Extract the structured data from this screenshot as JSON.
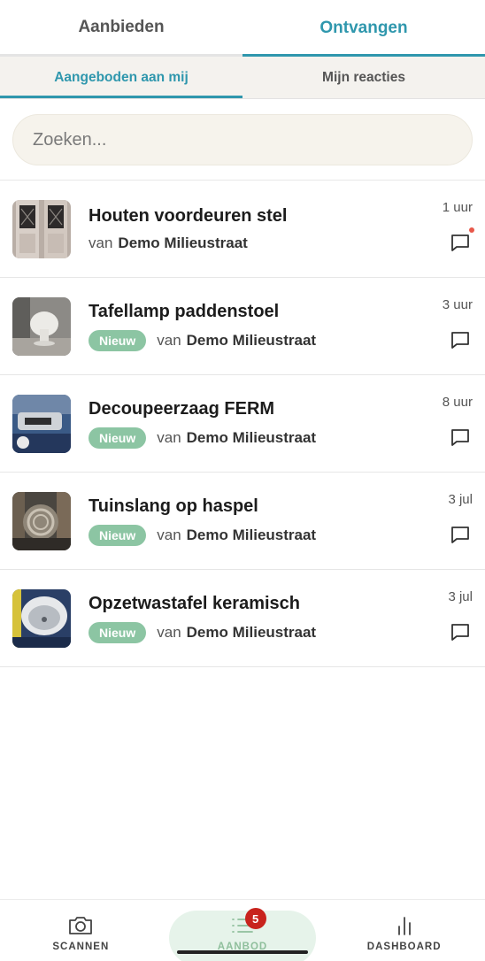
{
  "top_tabs": [
    {
      "label": "Aanbieden",
      "active": false
    },
    {
      "label": "Ontvangen",
      "active": true
    }
  ],
  "sub_tabs": [
    {
      "label": "Aangeboden aan mij",
      "active": true
    },
    {
      "label": "Mijn reacties",
      "active": false
    }
  ],
  "search": {
    "placeholder": "Zoeken..."
  },
  "items": [
    {
      "title": "Houten voordeuren stel",
      "badge": "",
      "from_label": "van",
      "from_name": "Demo Milieustraat",
      "time": "1 uur",
      "unread": true,
      "thumb": "doors"
    },
    {
      "title": "Tafellamp paddenstoel",
      "badge": "Nieuw",
      "from_label": "van",
      "from_name": "Demo Milieustraat",
      "time": "3 uur",
      "unread": false,
      "thumb": "lamp"
    },
    {
      "title": "Decoupeerzaag FERM",
      "badge": "Nieuw",
      "from_label": "van",
      "from_name": "Demo Milieustraat",
      "time": "8 uur",
      "unread": false,
      "thumb": "saw"
    },
    {
      "title": "Tuinslang op haspel",
      "badge": "Nieuw",
      "from_label": "van",
      "from_name": "Demo Milieustraat",
      "time": "3 jul",
      "unread": false,
      "thumb": "hose"
    },
    {
      "title": "Opzetwastafel keramisch",
      "badge": "Nieuw",
      "from_label": "van",
      "from_name": "Demo Milieustraat",
      "time": "3 jul",
      "unread": false,
      "thumb": "sink"
    }
  ],
  "bottom_nav": [
    {
      "label": "SCANNEN",
      "icon": "camera-icon",
      "active": false
    },
    {
      "label": "AANBOD",
      "icon": "list-icon",
      "active": true,
      "badge": "5"
    },
    {
      "label": "DASHBOARD",
      "icon": "bar-chart-icon",
      "active": false
    }
  ],
  "colors": {
    "accent": "#2f97ad",
    "badge_green": "#8cc5a3",
    "notification_red": "#c8231d"
  }
}
